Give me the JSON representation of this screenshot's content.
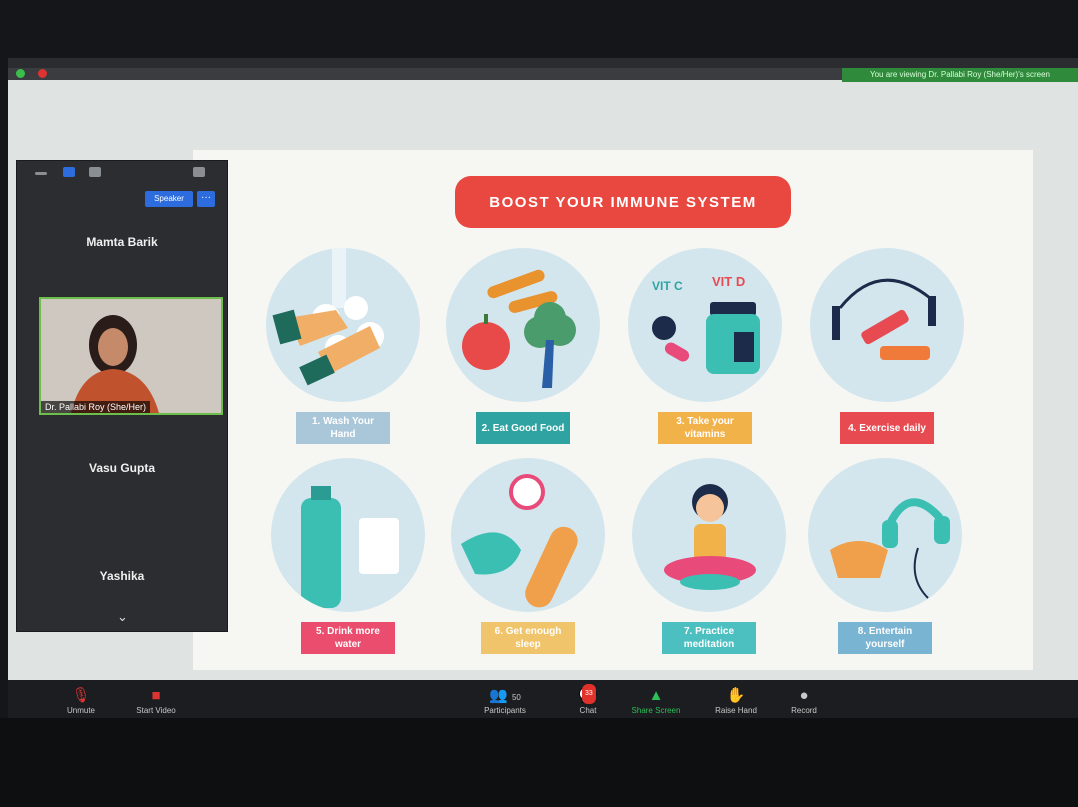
{
  "window": {
    "viewing_banner": "You are viewing Dr. Pallabi Roy (She/Her)'s screen"
  },
  "participants_panel": {
    "speaker_view_label": "Speaker",
    "more_label": "···",
    "participants": [
      {
        "name": "Mamta Barik"
      },
      {
        "name": "Dr. Pallabi Roy (She/Her)"
      },
      {
        "name": "Vasu Gupta"
      },
      {
        "name": "Yashika"
      }
    ]
  },
  "slide": {
    "title": "BOOST YOUR IMMUNE SYSTEM",
    "tips": [
      {
        "label": "1. Wash Your Hand",
        "color": "#a9c7d9"
      },
      {
        "label": "2. Eat Good Food",
        "color": "#2fa3a1"
      },
      {
        "label": "3. Take your vitamins",
        "color": "#f2b24a"
      },
      {
        "label": "4. Exercise daily",
        "color": "#e84a52"
      },
      {
        "label": "5. Drink more water",
        "color": "#ea4d6d"
      },
      {
        "label": "6. Get enough sleep",
        "color": "#f0c46a"
      },
      {
        "label": "7. Practice meditation",
        "color": "#4cbfc0"
      },
      {
        "label": "8. Entertain yourself",
        "color": "#7ab4d3"
      }
    ],
    "vitamin_labels": {
      "c": "VIT C",
      "d": "VIT D"
    }
  },
  "toolbar": {
    "unmute": "Unmute",
    "start_video": "Start Video",
    "participants": "Participants",
    "participants_count": "50",
    "chat": "Chat",
    "chat_badge": "33",
    "share_screen": "Share Screen",
    "raise_hand": "Raise Hand",
    "record": "Record"
  },
  "colors": {
    "title_pill": "#e8483f",
    "active_speaker_border": "#6bbf4a",
    "share_screen": "#2fbf5a",
    "banner": "#2f8a3b"
  }
}
